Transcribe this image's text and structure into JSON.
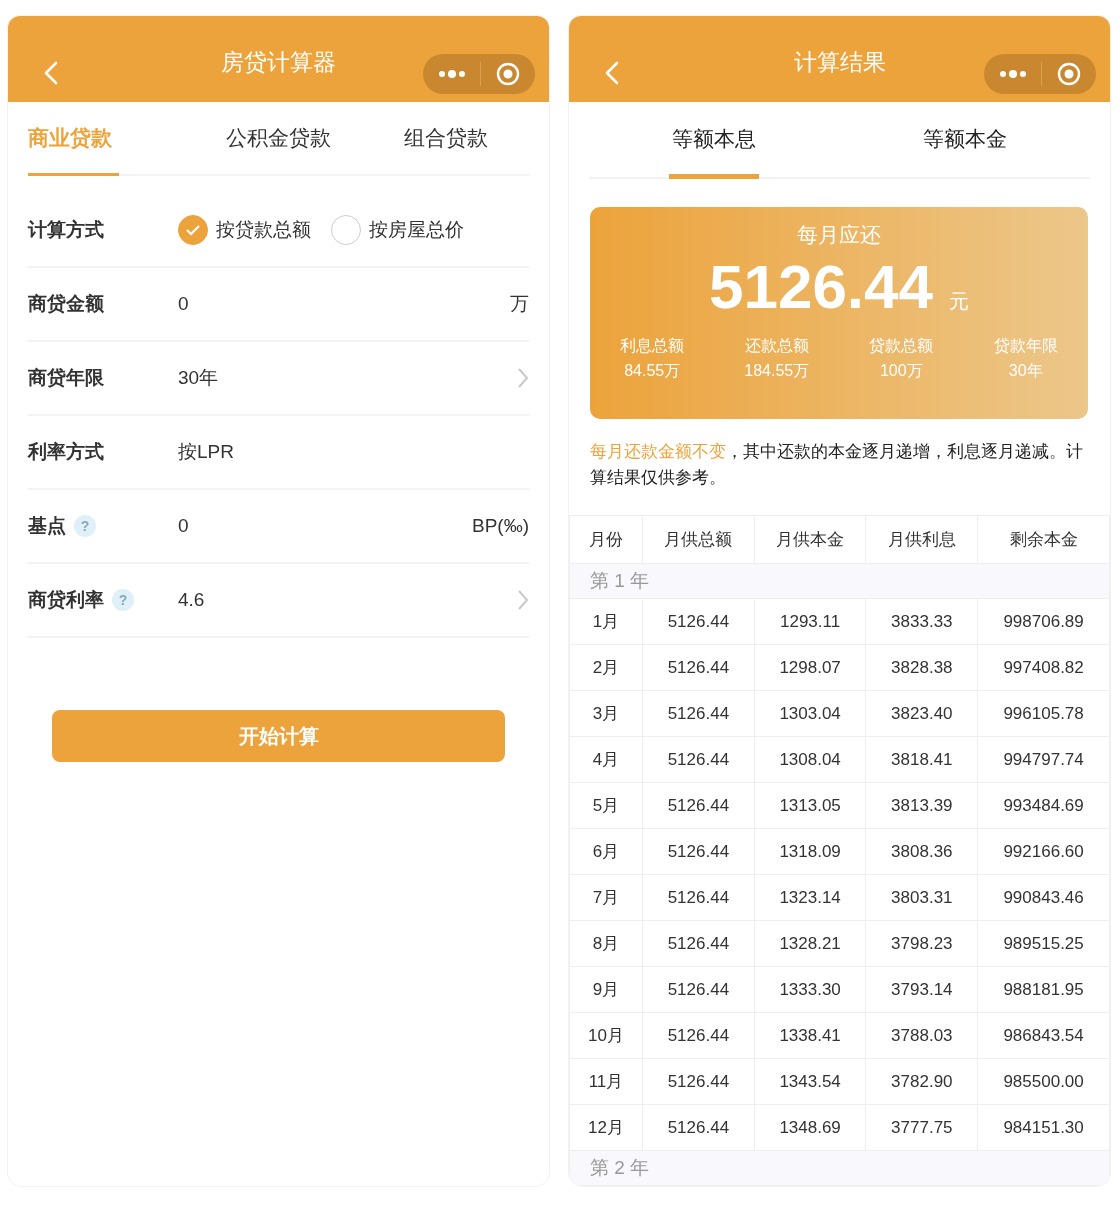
{
  "left_screen": {
    "nav_title": "房贷计算器",
    "tabs": [
      {
        "label": "商业贷款",
        "selected": true
      },
      {
        "label": "公积金贷款",
        "selected": false
      },
      {
        "label": "组合贷款",
        "selected": false
      }
    ],
    "form_rows": [
      {
        "kind": "radio",
        "label": "计算方式",
        "options": [
          {
            "label": "按贷款总额",
            "selected": true
          },
          {
            "label": "按房屋总价",
            "selected": false
          }
        ]
      },
      {
        "kind": "input",
        "label": "商贷金额",
        "value": "0",
        "unit": "万"
      },
      {
        "kind": "select",
        "label": "商贷年限",
        "value": "30年"
      },
      {
        "kind": "text",
        "label": "利率方式",
        "value": "按LPR"
      },
      {
        "kind": "input",
        "label": "基点",
        "help": "?",
        "value": "0",
        "unit": "BP(‰)"
      },
      {
        "kind": "select",
        "label": "商贷利率",
        "help": "?",
        "value": "4.6"
      }
    ],
    "submit_button": "开始计算"
  },
  "right_screen": {
    "nav_title": "计算结果",
    "tabs": [
      {
        "label": "等额本息",
        "selected": true
      },
      {
        "label": "等额本金",
        "selected": false
      }
    ],
    "summary": {
      "title": "每月应还",
      "amount": "5126.44",
      "currency": "元",
      "stats": [
        {
          "label": "利息总额",
          "value": "84.55万"
        },
        {
          "label": "还款总额",
          "value": "184.55万"
        },
        {
          "label": "贷款总额",
          "value": "100万"
        },
        {
          "label": "贷款年限",
          "value": "30年"
        }
      ]
    },
    "note": {
      "highlight": "每月还款金额不变",
      "text": "，其中还款的本金逐月递增，利息逐月递减。计算结果仅供参考。"
    },
    "table": {
      "columns": [
        "月份",
        "月供总额",
        "月供本金",
        "月供利息",
        "剩余本金"
      ],
      "groups": [
        {
          "label": "第 1 年",
          "rows": [
            [
              "1月",
              "5126.44",
              "1293.11",
              "3833.33",
              "998706.89"
            ],
            [
              "2月",
              "5126.44",
              "1298.07",
              "3828.38",
              "997408.82"
            ],
            [
              "3月",
              "5126.44",
              "1303.04",
              "3823.40",
              "996105.78"
            ],
            [
              "4月",
              "5126.44",
              "1308.04",
              "3818.41",
              "994797.74"
            ],
            [
              "5月",
              "5126.44",
              "1313.05",
              "3813.39",
              "993484.69"
            ],
            [
              "6月",
              "5126.44",
              "1318.09",
              "3808.36",
              "992166.60"
            ],
            [
              "7月",
              "5126.44",
              "1323.14",
              "3803.31",
              "990843.46"
            ],
            [
              "8月",
              "5126.44",
              "1328.21",
              "3798.23",
              "989515.25"
            ],
            [
              "9月",
              "5126.44",
              "1333.30",
              "3793.14",
              "988181.95"
            ],
            [
              "10月",
              "5126.44",
              "1338.41",
              "3788.03",
              "986843.54"
            ],
            [
              "11月",
              "5126.44",
              "1343.54",
              "3782.90",
              "985500.00"
            ],
            [
              "12月",
              "5126.44",
              "1348.69",
              "3777.75",
              "984151.30"
            ]
          ]
        },
        {
          "label": "第 2 年"
        }
      ]
    }
  }
}
